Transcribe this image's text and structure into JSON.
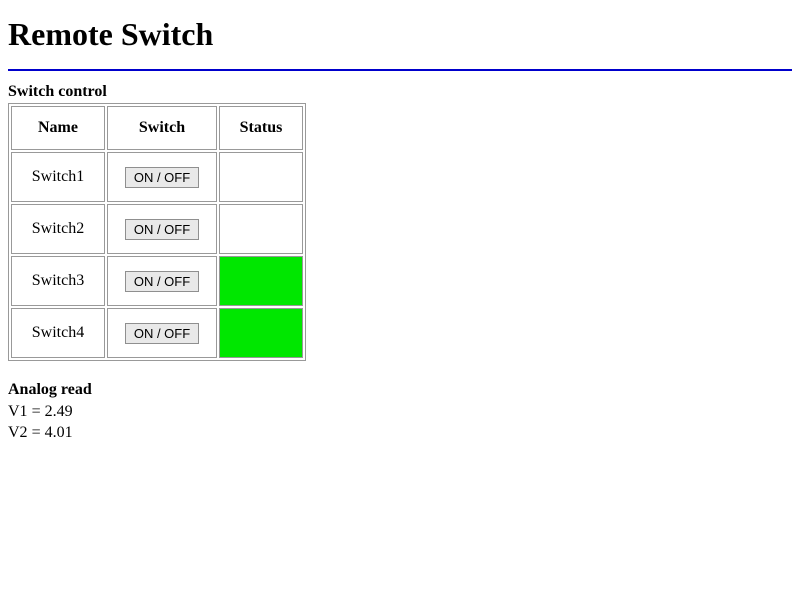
{
  "page": {
    "title": "Remote Switch"
  },
  "switch_section": {
    "heading": "Switch control",
    "columns": {
      "name": "Name",
      "switch": "Switch",
      "status": "Status"
    },
    "button_label": "ON / OFF",
    "rows": [
      {
        "name": "Switch1",
        "status_on": false
      },
      {
        "name": "Switch2",
        "status_on": false
      },
      {
        "name": "Switch3",
        "status_on": true
      },
      {
        "name": "Switch4",
        "status_on": true
      }
    ]
  },
  "analog_section": {
    "heading": "Analog read",
    "readings": [
      {
        "label": "V1",
        "value": "2.49"
      },
      {
        "label": "V2",
        "value": "4.01"
      }
    ]
  },
  "colors": {
    "rule": "#0000cc",
    "status_on": "#00e700"
  }
}
